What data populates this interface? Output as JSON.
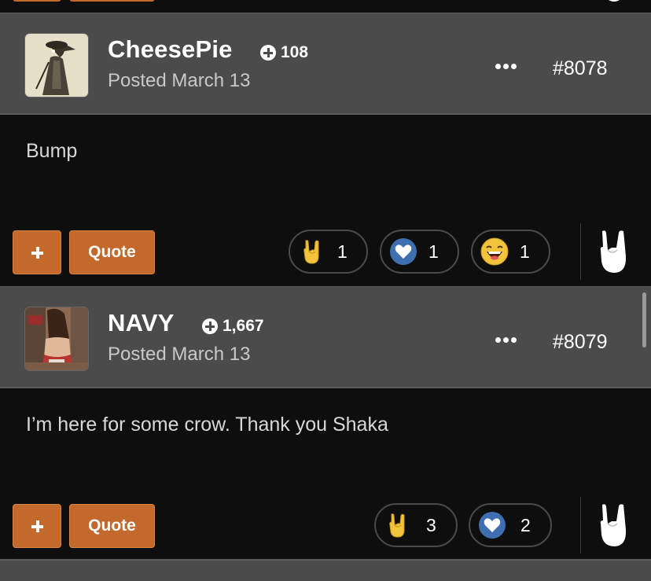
{
  "posts": [
    {
      "username": "CheesePie",
      "reputation": "108",
      "posted": "Posted March 13",
      "number": "#8078",
      "body": "Bump",
      "quote_label": "Quote",
      "reactions": [
        {
          "type": "rock-on",
          "count": "1"
        },
        {
          "type": "like-heart",
          "count": "1"
        },
        {
          "type": "haha",
          "count": "1"
        }
      ]
    },
    {
      "username": "NAVY",
      "reputation": "1,667",
      "posted": "Posted March 13",
      "number": "#8079",
      "body": "I’m here for some crow. Thank you Shaka",
      "quote_label": "Quote",
      "reactions": [
        {
          "type": "rock-on",
          "count": "3"
        },
        {
          "type": "like-heart",
          "count": "2"
        }
      ]
    }
  ],
  "colors": {
    "header_bg": "#4b4b4b",
    "body_bg": "#0e0e0e",
    "button_orange": "#c2692b",
    "like_blue": "#3f6fb0",
    "emoji_yellow": "#f2c43d"
  },
  "icons": {
    "rep": "plus-circle-icon",
    "more": "ellipsis-icon",
    "react": "rock-on-hand-icon"
  }
}
